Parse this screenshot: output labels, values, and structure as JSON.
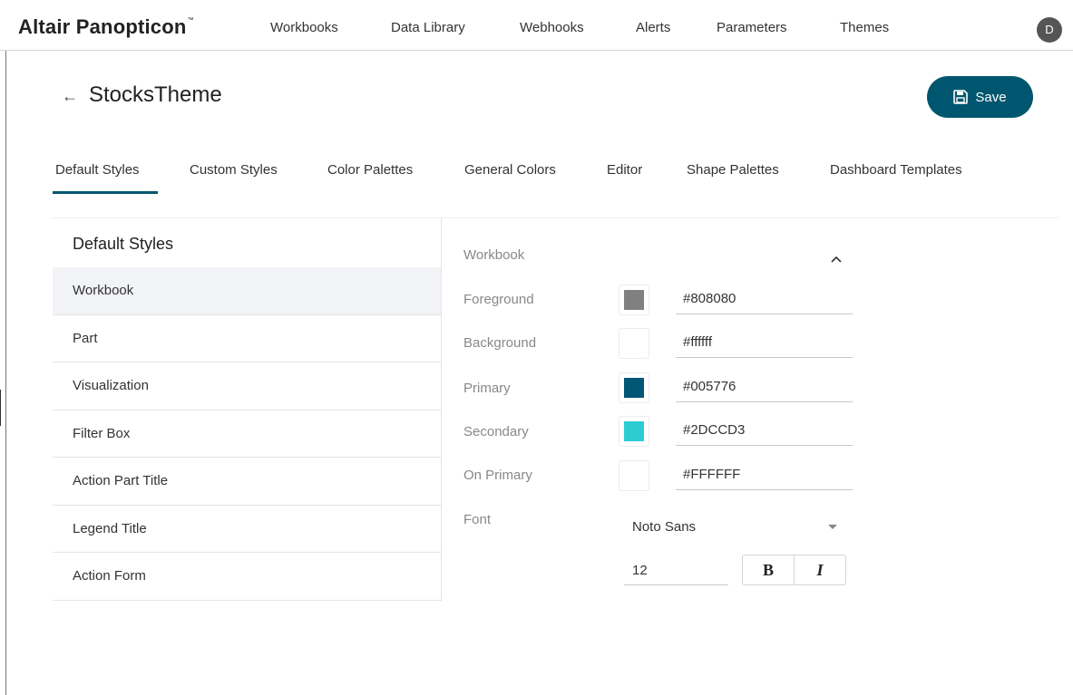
{
  "app": {
    "name": "Altair Panopticon",
    "trademark": "™"
  },
  "nav": {
    "items": [
      {
        "label": "Workbooks"
      },
      {
        "label": "Data Library"
      },
      {
        "label": "Webhooks"
      },
      {
        "label": "Alerts"
      },
      {
        "label": "Parameters"
      },
      {
        "label": "Themes"
      }
    ],
    "avatar_initial": "D"
  },
  "header": {
    "title": "StocksTheme",
    "back_icon": "arrow-left-icon",
    "save_label": "Save",
    "save_icon": "floppy-disk-icon"
  },
  "tabs": [
    {
      "label": "Default Styles",
      "active": true
    },
    {
      "label": "Custom Styles"
    },
    {
      "label": "Color Palettes"
    },
    {
      "label": "General Colors"
    },
    {
      "label": "Editor"
    },
    {
      "label": "Shape Palettes"
    },
    {
      "label": "Dashboard Templates"
    }
  ],
  "styles_list": {
    "heading": "Default Styles",
    "items": [
      {
        "label": "Workbook",
        "selected": true
      },
      {
        "label": "Part"
      },
      {
        "label": "Visualization"
      },
      {
        "label": "Filter Box"
      },
      {
        "label": "Action Part Title"
      },
      {
        "label": "Legend Title"
      },
      {
        "label": "Action Form"
      }
    ]
  },
  "workbook_section": {
    "title": "Workbook",
    "collapse_icon": "chevron-up-icon",
    "colors": [
      {
        "label": "Foreground",
        "value": "#808080",
        "swatch": "#808080"
      },
      {
        "label": "Background",
        "value": "#ffffff",
        "swatch": "#ffffff"
      },
      {
        "label": "Primary",
        "value": "#005776",
        "swatch": "#005776"
      },
      {
        "label": "Secondary",
        "value": "#2DCCD3",
        "swatch": "#2DCCD3"
      },
      {
        "label": "On Primary",
        "value": "#FFFFFF",
        "swatch": "#FFFFFF"
      }
    ],
    "font": {
      "label": "Font",
      "family": "Noto Sans",
      "size": "12",
      "bold_label": "B",
      "italic_label": "I"
    }
  },
  "theme_colors": {
    "accent": "#00566e",
    "active_row": "#f2f3f6"
  }
}
